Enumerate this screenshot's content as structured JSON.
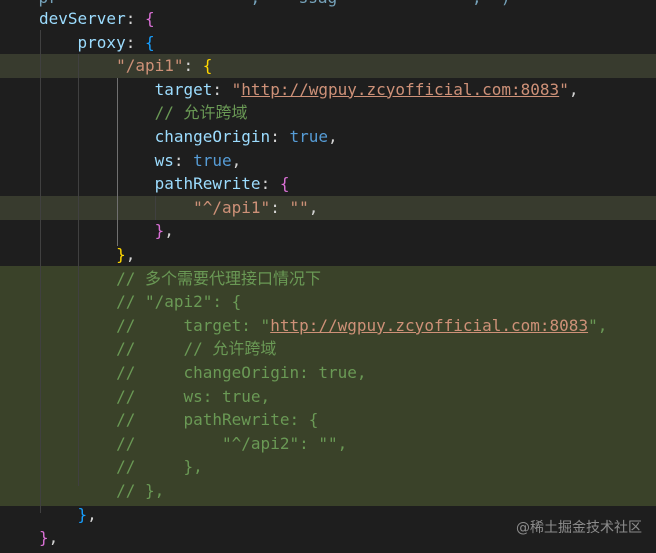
{
  "editor": {
    "top_clipped": "    pr                    ,    ssag              ,  )",
    "lines": [
      {
        "indent": "",
        "tokens": [
          {
            "t": "devServer",
            "c": "tok-prop"
          },
          {
            "t": ": ",
            "c": "tok-punc"
          },
          {
            "t": "{",
            "c": "tok-b2"
          }
        ]
      },
      {
        "indent": "    ",
        "tokens": [
          {
            "t": "proxy",
            "c": "tok-prop"
          },
          {
            "t": ": ",
            "c": "tok-punc"
          },
          {
            "t": "{",
            "c": "tok-b3"
          }
        ]
      },
      {
        "indent": "        ",
        "tokens": [
          {
            "t": "\"/api1\"",
            "c": "tok-str"
          },
          {
            "t": ": ",
            "c": "tok-punc"
          },
          {
            "t": "{",
            "c": "tok-b1"
          }
        ]
      },
      {
        "indent": "            ",
        "tokens": [
          {
            "t": "target",
            "c": "tok-prop"
          },
          {
            "t": ": ",
            "c": "tok-punc"
          },
          {
            "t": "\"",
            "c": "tok-str"
          },
          {
            "t": "http://wgpuy.zcyofficial.com:8083",
            "c": "tok-url"
          },
          {
            "t": "\"",
            "c": "tok-str"
          },
          {
            "t": ",",
            "c": "tok-punc"
          }
        ]
      },
      {
        "indent": "            ",
        "tokens": [
          {
            "t": "// 允许跨域",
            "c": "tok-cmt"
          }
        ]
      },
      {
        "indent": "            ",
        "tokens": [
          {
            "t": "changeOrigin",
            "c": "tok-prop"
          },
          {
            "t": ": ",
            "c": "tok-punc"
          },
          {
            "t": "true",
            "c": "tok-kw"
          },
          {
            "t": ",",
            "c": "tok-punc"
          }
        ]
      },
      {
        "indent": "            ",
        "tokens": [
          {
            "t": "ws",
            "c": "tok-prop"
          },
          {
            "t": ": ",
            "c": "tok-punc"
          },
          {
            "t": "true",
            "c": "tok-kw"
          },
          {
            "t": ",",
            "c": "tok-punc"
          }
        ]
      },
      {
        "indent": "            ",
        "tokens": [
          {
            "t": "pathRewrite",
            "c": "tok-prop"
          },
          {
            "t": ": ",
            "c": "tok-punc"
          },
          {
            "t": "{",
            "c": "tok-b2"
          }
        ]
      },
      {
        "indent": "                ",
        "tokens": [
          {
            "t": "\"^/api1\"",
            "c": "tok-str"
          },
          {
            "t": ": ",
            "c": "tok-punc"
          },
          {
            "t": "\"\"",
            "c": "tok-str"
          },
          {
            "t": ",",
            "c": "tok-punc"
          }
        ]
      },
      {
        "indent": "            ",
        "tokens": [
          {
            "t": "}",
            "c": "tok-b2"
          },
          {
            "t": ",",
            "c": "tok-punc"
          }
        ]
      },
      {
        "indent": "        ",
        "tokens": [
          {
            "t": "}",
            "c": "tok-b1"
          },
          {
            "t": ",",
            "c": "tok-punc"
          }
        ]
      },
      {
        "indent": "        ",
        "tokens": [
          {
            "t": "// 多个需要代理接口情况下",
            "c": "tok-cmt"
          }
        ]
      },
      {
        "indent": "        ",
        "tokens": [
          {
            "t": "// \"/api2\": {",
            "c": "tok-cmt"
          }
        ]
      },
      {
        "indent": "        ",
        "tokens": [
          {
            "t": "//     target: \"",
            "c": "tok-cmt"
          },
          {
            "t": "http://wgpuy.zcyofficial.com:8083",
            "c": "tok-url"
          },
          {
            "t": "\",",
            "c": "tok-cmt"
          }
        ]
      },
      {
        "indent": "        ",
        "tokens": [
          {
            "t": "//     // 允许跨域",
            "c": "tok-cmt"
          }
        ]
      },
      {
        "indent": "        ",
        "tokens": [
          {
            "t": "//     changeOrigin: true,",
            "c": "tok-cmt"
          }
        ]
      },
      {
        "indent": "        ",
        "tokens": [
          {
            "t": "//     ws: true,",
            "c": "tok-cmt"
          }
        ]
      },
      {
        "indent": "        ",
        "tokens": [
          {
            "t": "//     pathRewrite: {",
            "c": "tok-cmt"
          }
        ]
      },
      {
        "indent": "        ",
        "tokens": [
          {
            "t": "//         \"^/api2\": \"\",",
            "c": "tok-cmt"
          }
        ]
      },
      {
        "indent": "        ",
        "tokens": [
          {
            "t": "//     },",
            "c": "tok-cmt"
          }
        ]
      },
      {
        "indent": "        ",
        "tokens": [
          {
            "t": "// },",
            "c": "tok-cmt"
          }
        ]
      },
      {
        "indent": "    ",
        "tokens": [
          {
            "t": "}",
            "c": "tok-b3"
          },
          {
            "t": ",",
            "c": "tok-punc"
          }
        ]
      },
      {
        "indent": "",
        "tokens": [
          {
            "t": "}",
            "c": "tok-b2"
          },
          {
            "t": ",",
            "c": "tok-punc"
          }
        ]
      }
    ]
  },
  "watermark": "@稀土掘金技术社区",
  "colors": {
    "background": "#1e1e1e",
    "string": "#ce9178",
    "property": "#9cdcfe",
    "keyword": "#569cd6",
    "comment": "#6a9955",
    "selection": "#3a4229"
  }
}
